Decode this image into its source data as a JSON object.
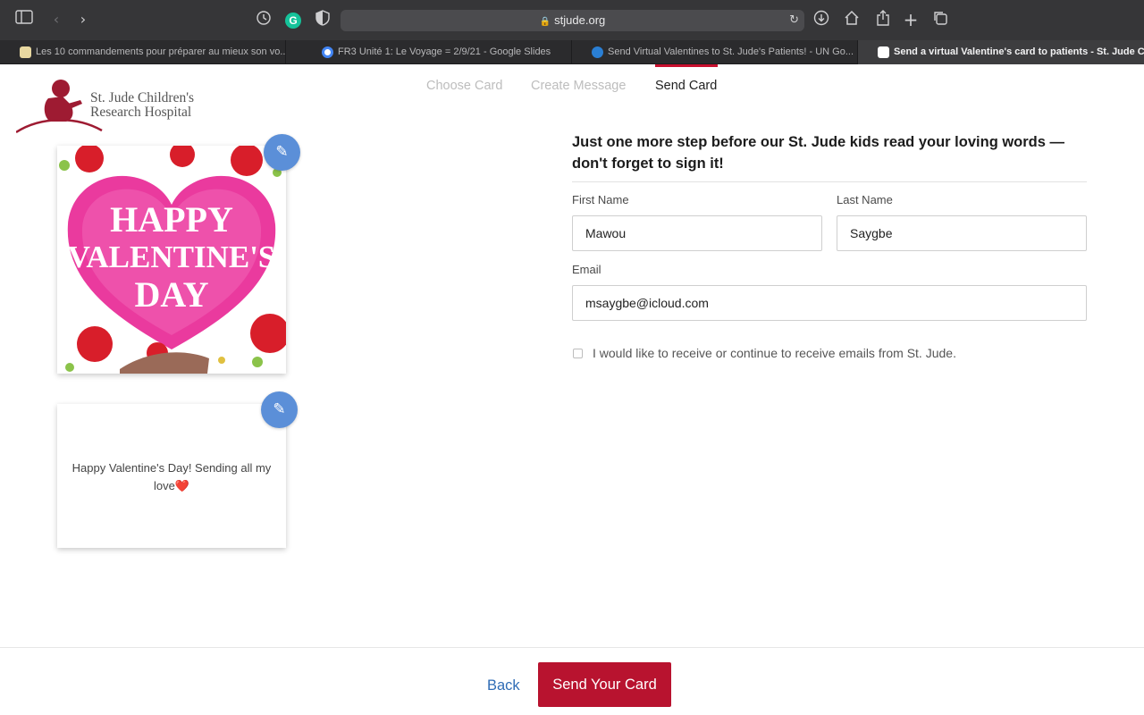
{
  "browser": {
    "url": "stjude.org",
    "toolbar_icons": [
      "sidebar-icon",
      "back-icon",
      "forward-icon",
      "history-icon",
      "grammarly-icon",
      "privacy-shield-icon",
      "reload-icon",
      "download-icon",
      "home-icon",
      "share-icon",
      "new-tab-icon",
      "tab-overview-icon"
    ],
    "grammarly_letter": "G",
    "tabs": [
      {
        "label": "Les 10 commandements pour préparer au mieux son vo...",
        "favicon_color": "#e8d8a0",
        "active": false
      },
      {
        "label": "FR3 Unité 1: Le Voyage = 2/9/21 - Google Slides",
        "favicon_color": "#4285f4",
        "active": false
      },
      {
        "label": "Send Virtual Valentines to St. Jude's Patients! - UN Go...",
        "favicon_color": "#2a7fd4",
        "active": false
      },
      {
        "label": "Send a virtual Valentine's card to patients - St. Jude C...",
        "favicon_color": "#c8102e",
        "active": true
      }
    ]
  },
  "logo": {
    "line1": "St. Jude Children's",
    "line2": "Research Hospital"
  },
  "steps": [
    {
      "label": "Choose Card",
      "active": false
    },
    {
      "label": "Create Message",
      "active": false
    },
    {
      "label": "Send Card",
      "active": true
    }
  ],
  "card": {
    "front_text": [
      "HAPPY",
      "VALENTINE'S",
      "DAY"
    ],
    "message": "Happy Valentine's Day! Sending all my love❤️"
  },
  "form": {
    "headline": "Just one more step before our St. Jude kids read your loving words — don't forget to sign it!",
    "first_name_label": "First Name",
    "first_name_value": "Mawou",
    "last_name_label": "Last Name",
    "last_name_value": "Saygbe",
    "email_label": "Email",
    "email_value": "msaygbe@icloud.com",
    "optin_label": "I would like to receive or continue to receive emails from St. Jude.",
    "optin_checked": false
  },
  "footer": {
    "back_label": "Back",
    "send_label": "Send Your Card"
  },
  "colors": {
    "brand_red": "#b8132f",
    "link_blue": "#2f6cb5",
    "edit_blue": "#5b8fd8"
  }
}
